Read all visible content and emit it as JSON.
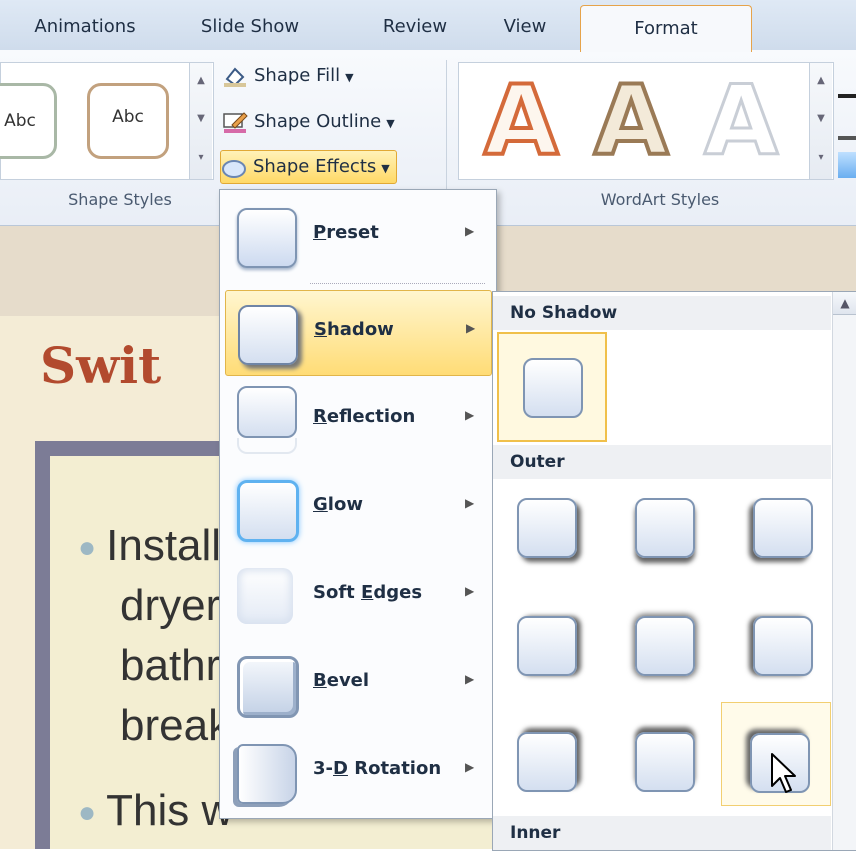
{
  "tabs": [
    "Animations",
    "Slide Show",
    "Review",
    "View",
    "Format"
  ],
  "active_tab": "Format",
  "ribbon": {
    "shape_style_tiles": [
      "Abc",
      "Abc"
    ],
    "shape_fill": "Shape Fill",
    "shape_outline": "Shape Outline",
    "shape_effects": "Shape Effects",
    "shape_styles_label": "Shape Styles",
    "wordart_styles_label": "WordArt Styles",
    "wordart_letters": [
      "A",
      "A",
      "A"
    ]
  },
  "slide": {
    "title": "Swit",
    "bullets": [
      "Install",
      "dryers",
      "bathro",
      "break",
      "This w"
    ]
  },
  "effects_menu": {
    "items": [
      {
        "label": "Preset"
      },
      {
        "label": "Shadow"
      },
      {
        "label": "Reflection"
      },
      {
        "label": "Glow"
      },
      {
        "label": "Soft Edges"
      },
      {
        "label": "Bevel"
      },
      {
        "label": "3-D Rotation"
      }
    ],
    "selected": "Shadow"
  },
  "shadow_menu": {
    "sections": [
      "No Shadow",
      "Outer",
      "Inner"
    ]
  },
  "colors": {
    "accent_highlight": "#ffd966",
    "slide_title": "#b24a2e",
    "tab_active_border": "#e6a34a"
  }
}
